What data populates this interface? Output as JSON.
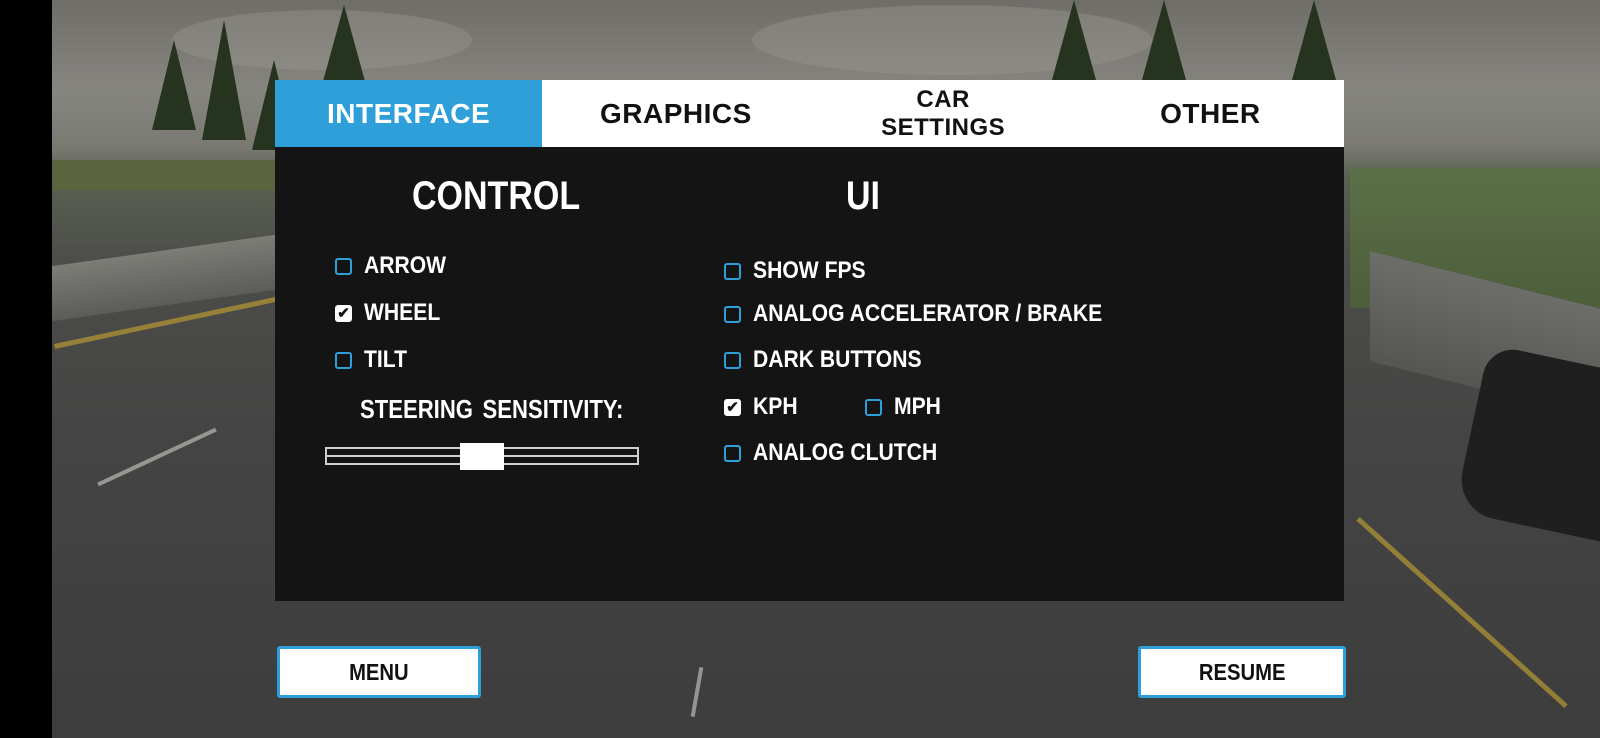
{
  "tabs": [
    {
      "label": "INTERFACE",
      "active": true
    },
    {
      "label": "GRAPHICS",
      "active": false
    },
    {
      "label": "CAR\nSETTINGS",
      "active": false
    },
    {
      "label": "OTHER",
      "active": false
    }
  ],
  "control": {
    "heading": "CONTROL",
    "options": [
      {
        "label": "ARROW",
        "checked": false
      },
      {
        "label": "WHEEL",
        "checked": true
      },
      {
        "label": "TILT",
        "checked": false
      }
    ],
    "steering_label": "STEERING  SENSITIVITY:",
    "steering_value": 0.5
  },
  "ui": {
    "heading": "UI",
    "options": [
      {
        "label": "SHOW FPS",
        "checked": false
      },
      {
        "label": "ANALOG ACCELERATOR / BRAKE",
        "checked": false
      },
      {
        "label": "DARK BUTTONS",
        "checked": false
      },
      {
        "label": "KPH",
        "checked": true
      },
      {
        "label": "MPH",
        "checked": false
      },
      {
        "label": "ANALOG CLUTCH",
        "checked": false
      }
    ]
  },
  "buttons": {
    "menu": "MENU",
    "resume": "RESUME"
  },
  "colors": {
    "accent": "#2e9fd8",
    "panel_bg": "#141414",
    "tab_bg": "#ffffff"
  }
}
